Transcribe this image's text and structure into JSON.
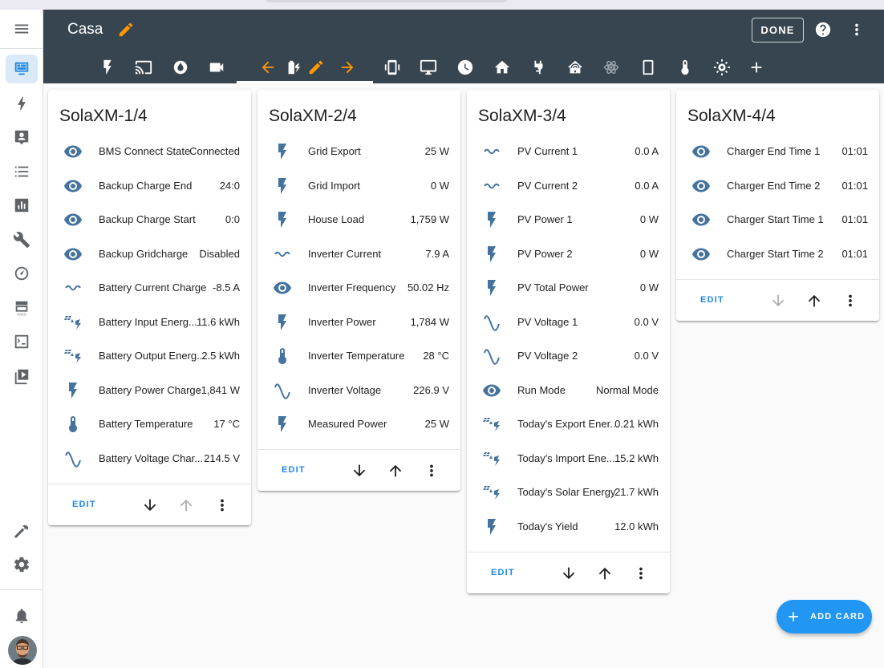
{
  "app": {
    "title": "Casa",
    "done_label": "DONE"
  },
  "colors": {
    "header": "#36454f",
    "accent": "#ff9800",
    "primary": "#1e88e5",
    "entity_icon": "#44739e"
  },
  "sidebar": {
    "items": [
      "menu-icon",
      "overview-icon",
      "energy-icon",
      "map-icon",
      "logbook-icon",
      "history-icon",
      "tools-icon",
      "speedometer-icon",
      "hacs-icon",
      "terminal-icon",
      "media-icon",
      "hammer-icon",
      "settings-icon",
      "bell-icon"
    ]
  },
  "view_tabs": [
    "flash",
    "cast",
    "water",
    "camera",
    "arrow-left",
    "solar-battery",
    "pencil",
    "arrow-right",
    "phone-vibrate",
    "monitor",
    "clock",
    "home",
    "power-plug",
    "home-automation",
    "atom",
    "tablet",
    "thermometer",
    "sun-cog",
    "plus"
  ],
  "cards": [
    {
      "title": "SolaXM-1/4",
      "rows": [
        {
          "icon": "eye",
          "name": "BMS Connect State",
          "value": "Connected"
        },
        {
          "icon": "current-ac",
          "name": "Backup Charge End",
          "value": "24:0",
          "eye": true
        },
        {
          "icon": "eye",
          "name": "Backup Charge Start",
          "value": "0:0"
        },
        {
          "icon": "eye",
          "name": "Backup Gridcharge",
          "value": "Disabled"
        },
        {
          "icon": "current-ac",
          "name": "Battery Current Charge",
          "value": "-8.5 A"
        },
        {
          "icon": "solar",
          "name": "Battery Input Energ...",
          "value": "11.6 kWh"
        },
        {
          "icon": "solar",
          "name": "Battery Output Energ...",
          "value": "2.5 kWh"
        },
        {
          "icon": "flash",
          "name": "Battery Power Charge",
          "value": "-1,841 W"
        },
        {
          "icon": "thermometer",
          "name": "Battery Temperature",
          "value": "17 °C"
        },
        {
          "icon": "sine",
          "name": "Battery Voltage Char...",
          "value": "214.5 V"
        }
      ],
      "edit": "EDIT"
    },
    {
      "title": "SolaXM-2/4",
      "rows": [
        {
          "icon": "flash",
          "name": "Grid Export",
          "value": "25 W"
        },
        {
          "icon": "flash",
          "name": "Grid Import",
          "value": "0 W"
        },
        {
          "icon": "flash",
          "name": "House Load",
          "value": "1,759 W"
        },
        {
          "icon": "current-ac",
          "name": "Inverter Current",
          "value": "7.9 A"
        },
        {
          "icon": "eye",
          "name": "Inverter Frequency",
          "value": "50.02 Hz"
        },
        {
          "icon": "flash",
          "name": "Inverter Power",
          "value": "1,784 W"
        },
        {
          "icon": "thermometer",
          "name": "Inverter Temperature",
          "value": "28 °C"
        },
        {
          "icon": "sine",
          "name": "Inverter Voltage",
          "value": "226.9 V"
        },
        {
          "icon": "flash",
          "name": "Measured Power",
          "value": "25 W"
        }
      ],
      "edit": "EDIT"
    },
    {
      "title": "SolaXM-3/4",
      "rows": [
        {
          "icon": "current-ac",
          "name": "PV Current 1",
          "value": "0.0 A"
        },
        {
          "icon": "current-ac",
          "name": "PV Current 2",
          "value": "0.0 A"
        },
        {
          "icon": "flash",
          "name": "PV Power 1",
          "value": "0 W"
        },
        {
          "icon": "flash",
          "name": "PV Power 2",
          "value": "0 W"
        },
        {
          "icon": "flash",
          "name": "PV Total Power",
          "value": "0 W"
        },
        {
          "icon": "sine",
          "name": "PV Voltage 1",
          "value": "0.0 V"
        },
        {
          "icon": "sine",
          "name": "PV Voltage 2",
          "value": "0.0 V"
        },
        {
          "icon": "eye",
          "name": "Run Mode",
          "value": "Normal Mode"
        },
        {
          "icon": "solar",
          "name": "Today's Export Ener...",
          "value": "0.21 kWh"
        },
        {
          "icon": "solar",
          "name": "Today's Import Ene...",
          "value": "15.2 kWh"
        },
        {
          "icon": "solar",
          "name": "Today's Solar Energy",
          "value": "21.7 kWh"
        },
        {
          "icon": "flash",
          "name": "Today's Yield",
          "value": "12.0 kWh"
        }
      ],
      "edit": "EDIT"
    },
    {
      "title": "SolaXM-4/4",
      "rows": [
        {
          "icon": "eye",
          "name": "Charger End Time 1",
          "value": "01:01"
        },
        {
          "icon": "eye",
          "name": "Charger End Time 2",
          "value": "01:01"
        },
        {
          "icon": "eye",
          "name": "Charger Start Time 1",
          "value": "01:01"
        },
        {
          "icon": "eye",
          "name": "Charger Start Time 2",
          "value": "01:01"
        }
      ],
      "edit": "EDIT"
    }
  ],
  "fab": {
    "label": "ADD CARD"
  }
}
